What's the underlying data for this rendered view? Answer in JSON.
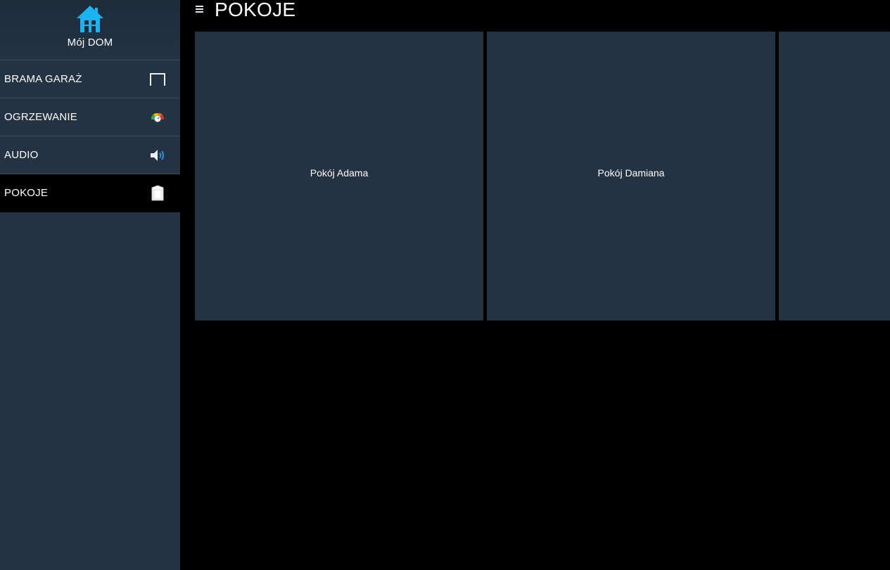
{
  "brand": {
    "title": "Mój DOM",
    "icon": "house-icon",
    "accent_color": "#1ab4f0"
  },
  "sidebar": {
    "items": [
      {
        "label": "BRAMA GARAŻ",
        "icon": "garage-door-icon",
        "active": false
      },
      {
        "label": "OGRZEWANIE",
        "icon": "thermostat-gauge-icon",
        "active": false
      },
      {
        "label": "AUDIO",
        "icon": "speaker-icon",
        "active": false
      },
      {
        "label": "POKOJE",
        "icon": "door-icon",
        "active": true
      }
    ]
  },
  "header": {
    "menu_icon": "hamburger-menu-icon",
    "title": "POKOJE"
  },
  "rooms": [
    {
      "label": "Pokój Adama"
    },
    {
      "label": "Pokój Damiana"
    },
    {
      "label": ""
    }
  ],
  "colors": {
    "sidebar_bg": "#233344",
    "tile_bg": "#233344",
    "page_bg": "#000000",
    "text": "#ffffff"
  }
}
